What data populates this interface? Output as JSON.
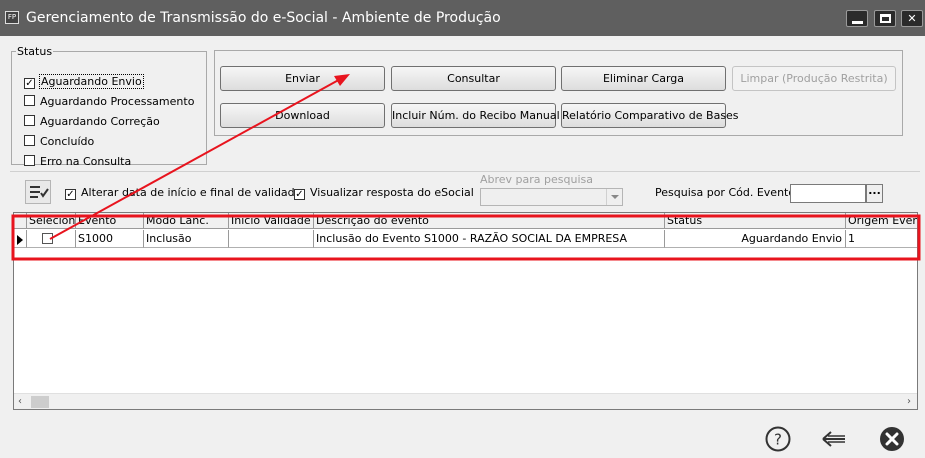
{
  "window": {
    "icon_text": "FP",
    "title": "Gerenciamento de Transmissão do e-Social - Ambiente de Produção"
  },
  "status": {
    "legend": "Status",
    "items": [
      {
        "label": "Aguardando Envio",
        "checked": true
      },
      {
        "label": "Aguardando Processamento",
        "checked": false
      },
      {
        "label": "Aguardando Correção",
        "checked": false
      },
      {
        "label": "Concluído",
        "checked": false
      },
      {
        "label": "Erro na Consulta",
        "checked": false
      }
    ]
  },
  "actions": {
    "enviar": "Enviar",
    "consultar": "Consultar",
    "eliminar_carga": "Eliminar Carga",
    "limpar": "Limpar (Produção Restrita)",
    "download": "Download",
    "incluir_recibo": "Incluir Núm. do Recibo Manual",
    "relatorio": "Relatório Comparativo de Bases"
  },
  "options": {
    "alterar_data": "Alterar data de início e final de validade.",
    "alterar_data_checked": true,
    "visualizar_resposta": "Visualizar resposta do eSocial",
    "visualizar_resposta_checked": true,
    "abrev_label": "Abrev para pesquisa",
    "cod_evento_label": "Pesquisa por Cód. Evento:",
    "cod_evento_value": "",
    "ellipsis": "..."
  },
  "grid": {
    "columns": [
      "Seleciona",
      "Evento",
      "Modo Lanc.",
      "Início Validade",
      "Descrição do evento",
      "Status",
      "Origem Evento"
    ],
    "rows": [
      {
        "selected": false,
        "evento": "S1000",
        "modo": "Inclusão",
        "inicio": "",
        "descricao": "Inclusão do Evento S1000 - RAZÃO SOCIAL DA EMPRESA",
        "status": "Aguardando Envio",
        "origem": "1"
      }
    ]
  },
  "colors": {
    "titlebar": "#5f5f5f",
    "annotation_red": "#e8141e"
  },
  "icons": {
    "help": "question-circle-icon",
    "back": "arrow-left-icon",
    "close": "close-circle-icon"
  }
}
